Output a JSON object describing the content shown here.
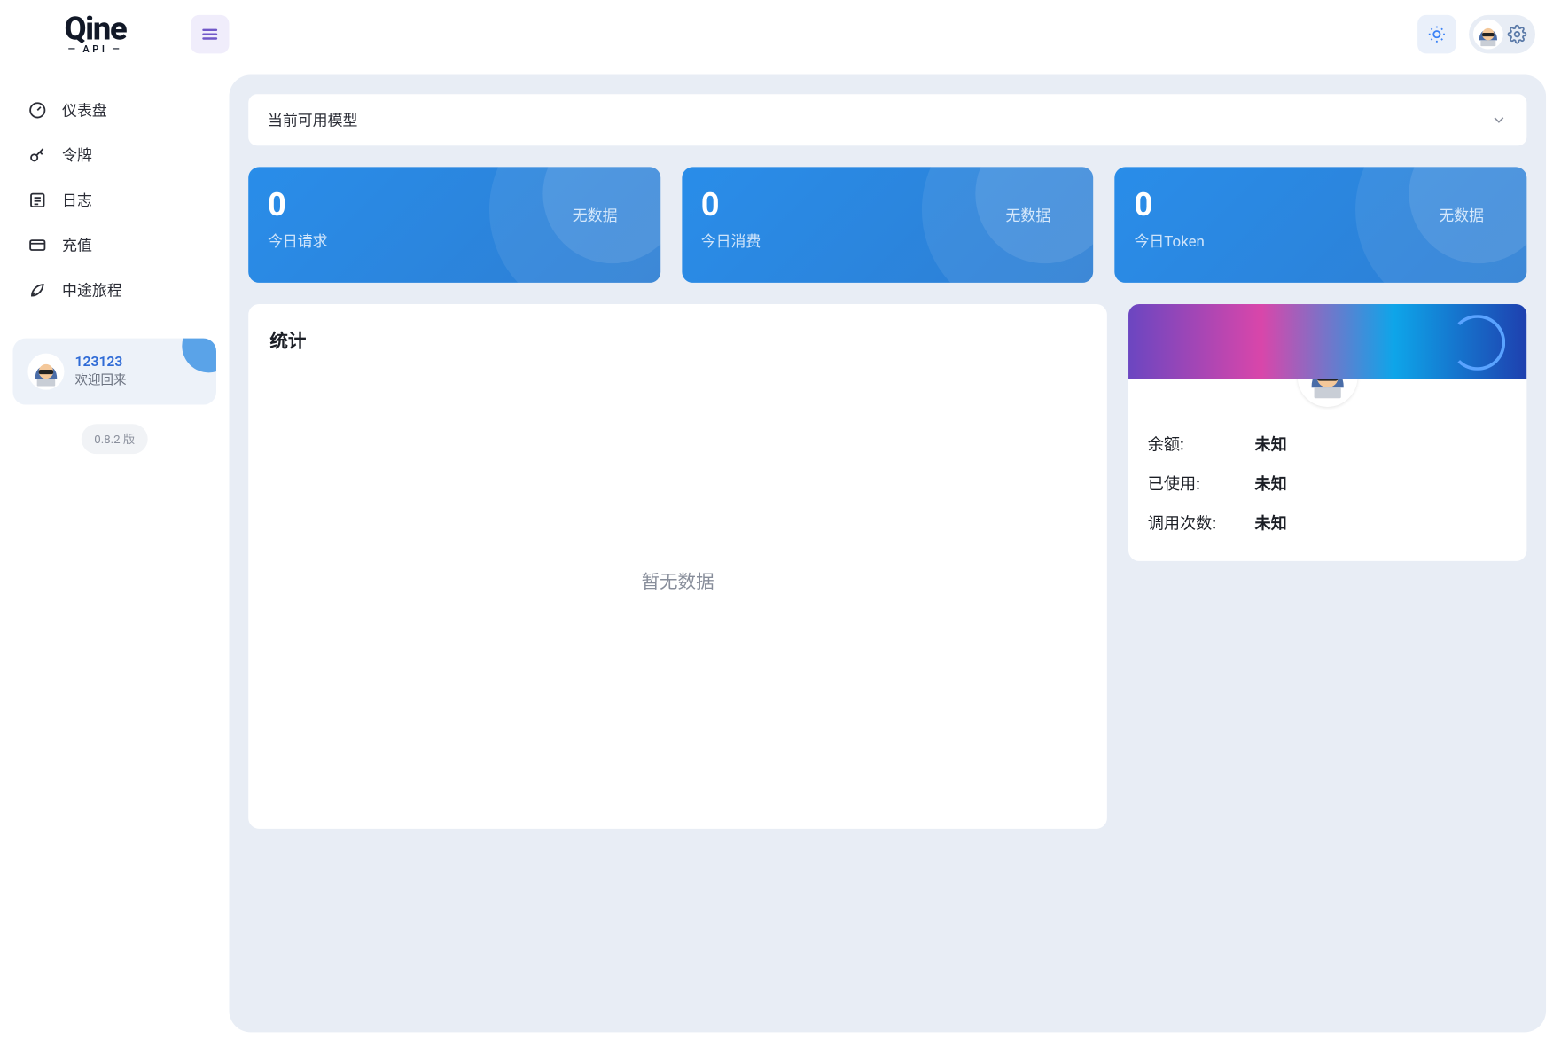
{
  "logo": {
    "main": "Qine",
    "sub": "API"
  },
  "sidebar": {
    "items": [
      {
        "label": "仪表盘"
      },
      {
        "label": "令牌"
      },
      {
        "label": "日志"
      },
      {
        "label": "充值"
      },
      {
        "label": "中途旅程"
      }
    ]
  },
  "userCard": {
    "uid": "123123",
    "welcome": "欢迎回来"
  },
  "version": "0.8.2 版",
  "dropdown": {
    "label": "当前可用模型"
  },
  "statCards": [
    {
      "value": "0",
      "label": "今日请求",
      "nodata": "无数据"
    },
    {
      "value": "0",
      "label": "今日消费",
      "nodata": "无数据"
    },
    {
      "value": "0",
      "label": "今日Token",
      "nodata": "无数据"
    }
  ],
  "statsPanel": {
    "title": "统计",
    "empty": "暂无数据"
  },
  "profile": {
    "rows": [
      {
        "label": "余额:",
        "value": "未知"
      },
      {
        "label": "已使用:",
        "value": "未知"
      },
      {
        "label": "调用次数:",
        "value": "未知"
      }
    ]
  }
}
